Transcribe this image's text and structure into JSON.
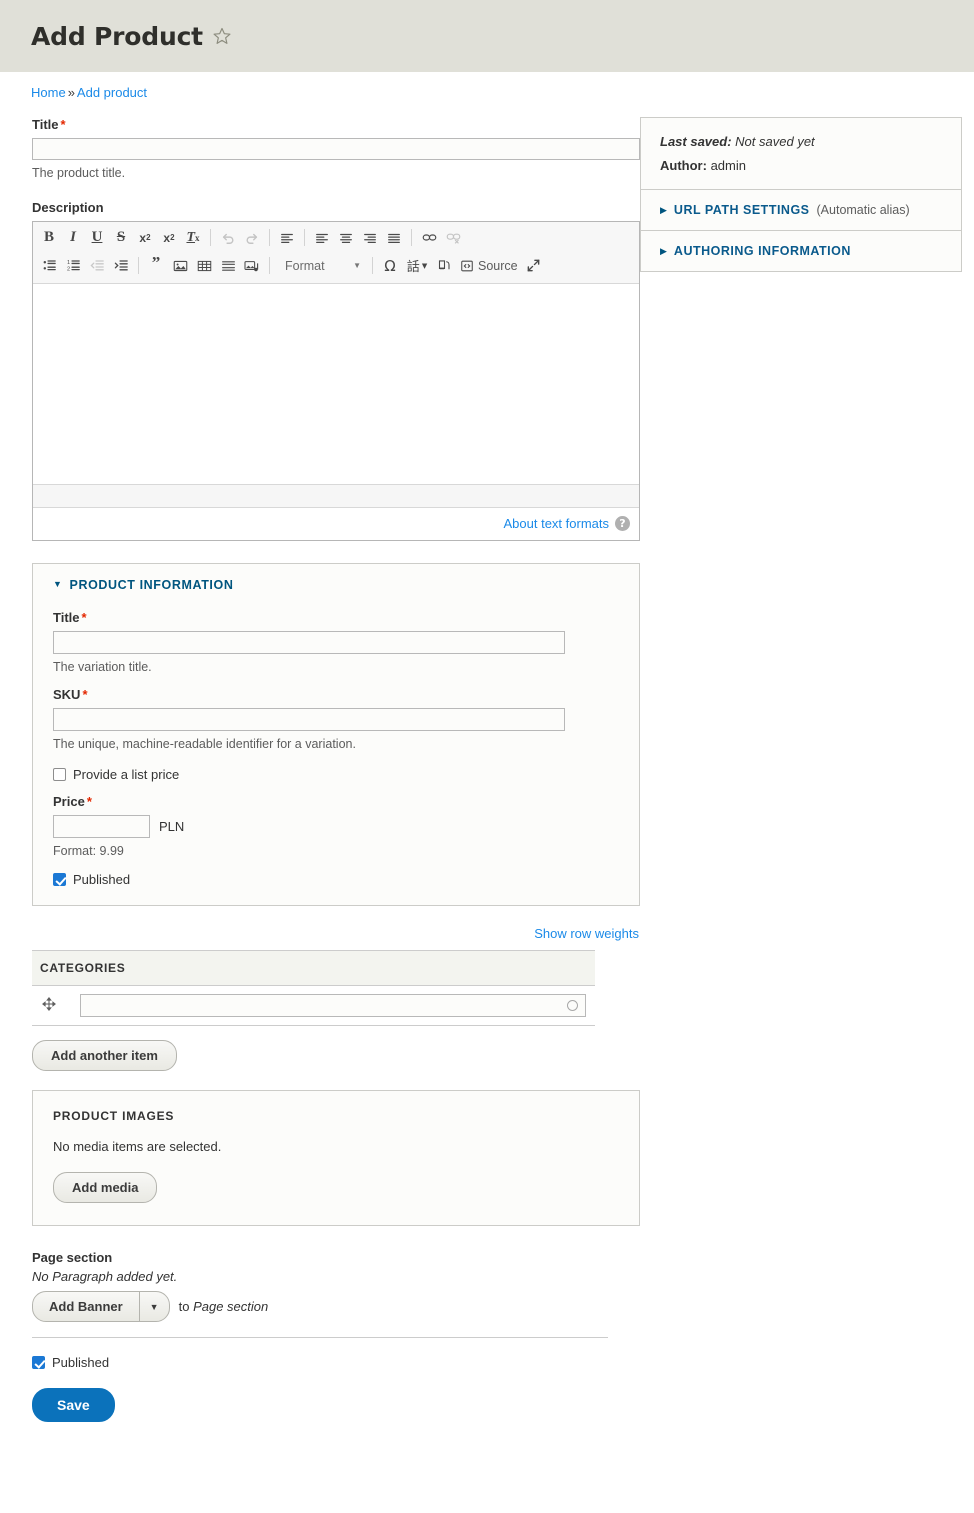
{
  "header": {
    "title": "Add Product",
    "star_icon": "star-outline-icon"
  },
  "breadcrumb": {
    "home": "Home",
    "separator": "»",
    "current": "Add product"
  },
  "form": {
    "title_label": "Title",
    "title_required_mark": "*",
    "title_value": "",
    "title_description": "The product title.",
    "description_label": "Description"
  },
  "editor": {
    "toolbar_row1": [
      {
        "name": "bold-icon",
        "glyph": "B",
        "style": "bold-serif",
        "disabled": false
      },
      {
        "name": "italic-icon",
        "glyph": "I",
        "style": "italic-serif",
        "disabled": false
      },
      {
        "name": "underline-icon",
        "glyph": "U",
        "style": "underline-serif",
        "disabled": false
      },
      {
        "name": "strikethrough-icon",
        "glyph": "S",
        "style": "strike-serif",
        "disabled": false
      },
      {
        "name": "superscript-icon",
        "glyph": "x²",
        "style": "plain",
        "disabled": false
      },
      {
        "name": "subscript-icon",
        "glyph": "x₂",
        "style": "plain",
        "disabled": false
      },
      {
        "name": "remove-format-icon",
        "glyph": "Tx",
        "style": "italic-serif",
        "disabled": false
      },
      {
        "name": "separator",
        "glyph": "",
        "style": "sep",
        "disabled": false
      },
      {
        "name": "undo-icon",
        "glyph": "↰",
        "style": "plain",
        "disabled": true
      },
      {
        "name": "redo-icon",
        "glyph": "↱",
        "style": "plain",
        "disabled": true
      },
      {
        "name": "separator",
        "glyph": "",
        "style": "sep",
        "disabled": false
      },
      {
        "name": "align-left-icon",
        "glyph": "≡",
        "style": "align-left",
        "disabled": false
      },
      {
        "name": "align-left-2-icon",
        "glyph": "≡",
        "style": "align-left",
        "disabled": false
      },
      {
        "name": "align-center-icon",
        "glyph": "≡",
        "style": "align-center",
        "disabled": false
      },
      {
        "name": "align-right-icon",
        "glyph": "≡",
        "style": "align-right",
        "disabled": false
      },
      {
        "name": "align-justify-icon",
        "glyph": "≡",
        "style": "align-justify",
        "disabled": false
      },
      {
        "name": "separator",
        "glyph": "",
        "style": "sep",
        "disabled": false
      },
      {
        "name": "link-icon",
        "glyph": "🔗",
        "style": "plain",
        "disabled": false
      },
      {
        "name": "unlink-icon",
        "glyph": "🔗",
        "style": "plain",
        "disabled": true
      }
    ],
    "toolbar_row2": [
      {
        "name": "bulleted-list-icon",
        "glyph": "⁝≡",
        "style": "list-bullet",
        "disabled": false
      },
      {
        "name": "numbered-list-icon",
        "glyph": "1≡",
        "style": "list-number",
        "disabled": false
      },
      {
        "name": "outdent-icon",
        "glyph": "⇤≡",
        "style": "indent",
        "disabled": true
      },
      {
        "name": "indent-icon",
        "glyph": "⇥≡",
        "style": "indent",
        "disabled": false
      },
      {
        "name": "separator",
        "glyph": "",
        "style": "sep",
        "disabled": false
      },
      {
        "name": "blockquote-icon",
        "glyph": "❞",
        "style": "quote",
        "disabled": false
      },
      {
        "name": "image-icon",
        "glyph": "🖼",
        "style": "plain",
        "disabled": false
      },
      {
        "name": "table-icon",
        "glyph": "▦",
        "style": "plain",
        "disabled": false
      },
      {
        "name": "horizontal-rule-icon",
        "glyph": "▤",
        "style": "plain",
        "disabled": false
      },
      {
        "name": "media-embed-icon",
        "glyph": "🎞",
        "style": "plain",
        "disabled": false
      },
      {
        "name": "separator",
        "glyph": "",
        "style": "sep",
        "disabled": false
      }
    ],
    "format_combo_label": "Format",
    "toolbar_row2_tail": [
      {
        "name": "special-character-icon",
        "glyph": "Ω",
        "style": "plain",
        "disabled": false
      },
      {
        "name": "language-icon",
        "glyph": "話",
        "style": "lang",
        "disabled": false
      },
      {
        "name": "anchor-icon",
        "glyph": "⚓",
        "style": "plain",
        "disabled": false
      }
    ],
    "source_label": "Source",
    "maximize_icon": "maximize-icon",
    "body_value": "",
    "about_text_formats": "About text formats",
    "help_glyph": "?"
  },
  "product_information": {
    "summary": "Product information",
    "title_label": "Title",
    "title_required_mark": "*",
    "title_value": "",
    "title_description": "The variation title.",
    "sku_label": "SKU",
    "sku_required_mark": "*",
    "sku_value": "",
    "sku_description": "The unique, machine-readable identifier for a variation.",
    "list_price_checkbox_label": "Provide a list price",
    "list_price_checked": false,
    "price_label": "Price",
    "price_required_mark": "*",
    "price_value": "",
    "price_currency": "PLN",
    "price_description": "Format: 9.99",
    "published_label": "Published",
    "published_checked": true
  },
  "categories": {
    "show_row_weights": "Show row weights",
    "column_header": "Categories",
    "drag_handle_icon": "drag-handle-icon",
    "value": "",
    "add_another_label": "Add another item"
  },
  "product_images": {
    "label": "Product images",
    "empty_text": "No media items are selected.",
    "add_media_label": "Add media"
  },
  "page_section": {
    "label": "Page section",
    "empty_text": "No Paragraph added yet.",
    "add_button_label": "Add Banner",
    "dropdown_icon": "chevron-down-icon",
    "suffix_prefix": "to ",
    "suffix_target": "Page section"
  },
  "footer": {
    "published_label": "Published",
    "published_checked": true,
    "save_label": "Save"
  },
  "sidebar": {
    "last_saved_label": "Last saved:",
    "last_saved_value": "Not saved yet",
    "author_label": "Author:",
    "author_value": "admin",
    "items": [
      {
        "label": "URL path settings",
        "extra": "(Automatic alias)",
        "triangle": "▶",
        "name": "url-path-settings"
      },
      {
        "label": "Authoring information",
        "extra": "",
        "triangle": "▶",
        "name": "authoring-information"
      }
    ]
  },
  "colors": {
    "header_bg": "#e0e0d8",
    "link": "#1b8ae8",
    "heading_blue": "#0a5a8c",
    "required_red": "#e32700",
    "primary_button": "#0b72bb",
    "checkbox_checked": "#1b78d4"
  }
}
